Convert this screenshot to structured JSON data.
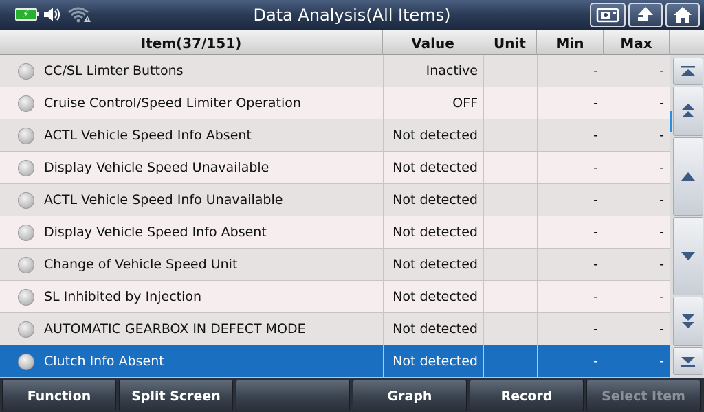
{
  "header": {
    "title": "Data Analysis(All Items)",
    "buttons": [
      {
        "name": "screenshot-button",
        "icon": "screenshot-icon"
      },
      {
        "name": "back-button",
        "icon": "return-arrow-icon"
      },
      {
        "name": "home-button",
        "icon": "home-icon"
      }
    ],
    "status_icons": [
      "battery-charging-icon",
      "volume-icon",
      "wifi-warning-icon"
    ]
  },
  "table": {
    "columns": [
      "Item(37/151)",
      "Value",
      "Unit",
      "Min",
      "Max"
    ],
    "rows": [
      {
        "item": "CC/SL Limter Buttons",
        "value": "Inactive",
        "unit": "",
        "min": "-",
        "max": "-"
      },
      {
        "item": "Cruise Control/Speed Limiter Operation",
        "value": "OFF",
        "unit": "",
        "min": "-",
        "max": "-"
      },
      {
        "item": "ACTL Vehicle Speed Info Absent",
        "value": "Not detected",
        "unit": "",
        "min": "-",
        "max": "-"
      },
      {
        "item": "Display Vehicle Speed Unavailable",
        "value": "Not detected",
        "unit": "",
        "min": "-",
        "max": "-"
      },
      {
        "item": "ACTL Vehicle Speed Info Unavailable",
        "value": "Not detected",
        "unit": "",
        "min": "-",
        "max": "-"
      },
      {
        "item": "Display Vehicle Speed Info Absent",
        "value": "Not detected",
        "unit": "",
        "min": "-",
        "max": "-"
      },
      {
        "item": "Change of Vehicle Speed Unit",
        "value": "Not detected",
        "unit": "",
        "min": "-",
        "max": "-"
      },
      {
        "item": "SL Inhibited by Injection",
        "value": "Not detected",
        "unit": "",
        "min": "-",
        "max": "-"
      },
      {
        "item": "AUTOMATIC GEARBOX IN DEFECT MODE",
        "value": "Not detected",
        "unit": "",
        "min": "-",
        "max": "-"
      },
      {
        "item": "Clutch Info Absent",
        "value": "Not detected",
        "unit": "",
        "min": "-",
        "max": "-"
      }
    ],
    "selected_index": 9
  },
  "scroll_buttons": [
    "scroll-top-icon",
    "page-up-icon",
    "scroll-up-icon",
    "scroll-down-icon",
    "page-down-icon",
    "scroll-bottom-icon"
  ],
  "bottom": {
    "function": "Function",
    "split_screen": "Split Screen",
    "empty": "",
    "graph": "Graph",
    "record": "Record",
    "select_item": "Select Item"
  },
  "colors": {
    "selected_row": "#1b6fc0",
    "accent": "#2b8fe0",
    "battery": "#28b12e"
  }
}
